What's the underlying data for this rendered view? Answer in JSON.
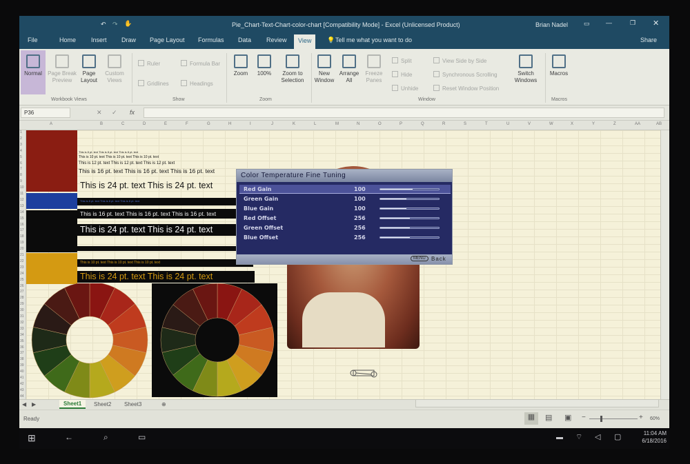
{
  "window": {
    "title": "Pie_Chart-Text-Chart-color-chart  [Compatibility Mode] - Excel (Unlicensed Product)",
    "user": "Brian Nadel",
    "share": "Share"
  },
  "tabs": [
    "File",
    "Home",
    "Insert",
    "Draw",
    "Page Layout",
    "Formulas",
    "Data",
    "Review",
    "View"
  ],
  "active_tab": "View",
  "tell_me": "Tell me what you want to do",
  "ribbon": {
    "workbook_views": {
      "label": "Workbook Views",
      "normal": "Normal",
      "page_break": "Page Break Preview",
      "page_layout": "Page Layout",
      "custom": "Custom Views"
    },
    "show": {
      "label": "Show",
      "ruler": "Ruler",
      "formula_bar": "Formula Bar",
      "gridlines": "Gridlines",
      "headings": "Headings"
    },
    "zoom": {
      "label": "Zoom",
      "zoom": "Zoom",
      "hundred": "100%",
      "selection": "Zoom to Selection"
    },
    "window": {
      "label": "Window",
      "new": "New Window",
      "arrange": "Arrange All",
      "freeze": "Freeze Panes",
      "split": "Split",
      "hide": "Hide",
      "unhide": "Unhide",
      "side_by_side": "View Side by Side",
      "sync": "Synchronous Scrolling",
      "reset": "Reset Window Position",
      "switch": "Switch Windows"
    },
    "macros": {
      "label": "Macros",
      "macros": "Macros"
    }
  },
  "name_box": "P36",
  "fx": "fx",
  "text_samples": {
    "t8": "This is 8 pt. text  This is 8 pt. text  This is 8 pt. text",
    "t10": "This is 10 pt. text   This is 10 pt. text   This is 10 pt. text",
    "t12": "This is 12 pt. text   This is 12 pt. text   This is 12 pt. text",
    "t16": "This is 16 pt. text   This is 16 pt. text   This is 16 pt. text",
    "t24": "This is 24 pt. text   This is 24 pt. text"
  },
  "osd": {
    "title": "Color Temperature Fine Tuning",
    "rows": [
      {
        "label": "Red Gain",
        "value": "100",
        "level": 0.55
      },
      {
        "label": "Green Gain",
        "value": "100",
        "level": 0.45
      },
      {
        "label": "Blue Gain",
        "value": "100",
        "level": 0.45
      },
      {
        "label": "Red Offset",
        "value": "256",
        "level": 0.5
      },
      {
        "label": "Green Offset",
        "value": "256",
        "level": 0.5
      },
      {
        "label": "Blue Offset",
        "value": "256",
        "level": 0.5
      }
    ],
    "menu_key": "MENU",
    "back": "Back"
  },
  "sheets": [
    "Sheet1",
    "Sheet2",
    "Sheet3"
  ],
  "status": {
    "ready": "Ready",
    "zoom": "60%"
  },
  "clock": {
    "time": "11:04 AM",
    "date": "6/18/2016"
  },
  "colors": {
    "maroon": "#8a1d12",
    "blue": "#1d3f9e",
    "black": "#0b0b0b",
    "gold": "#d49a12",
    "accent": "#1f4a63"
  }
}
